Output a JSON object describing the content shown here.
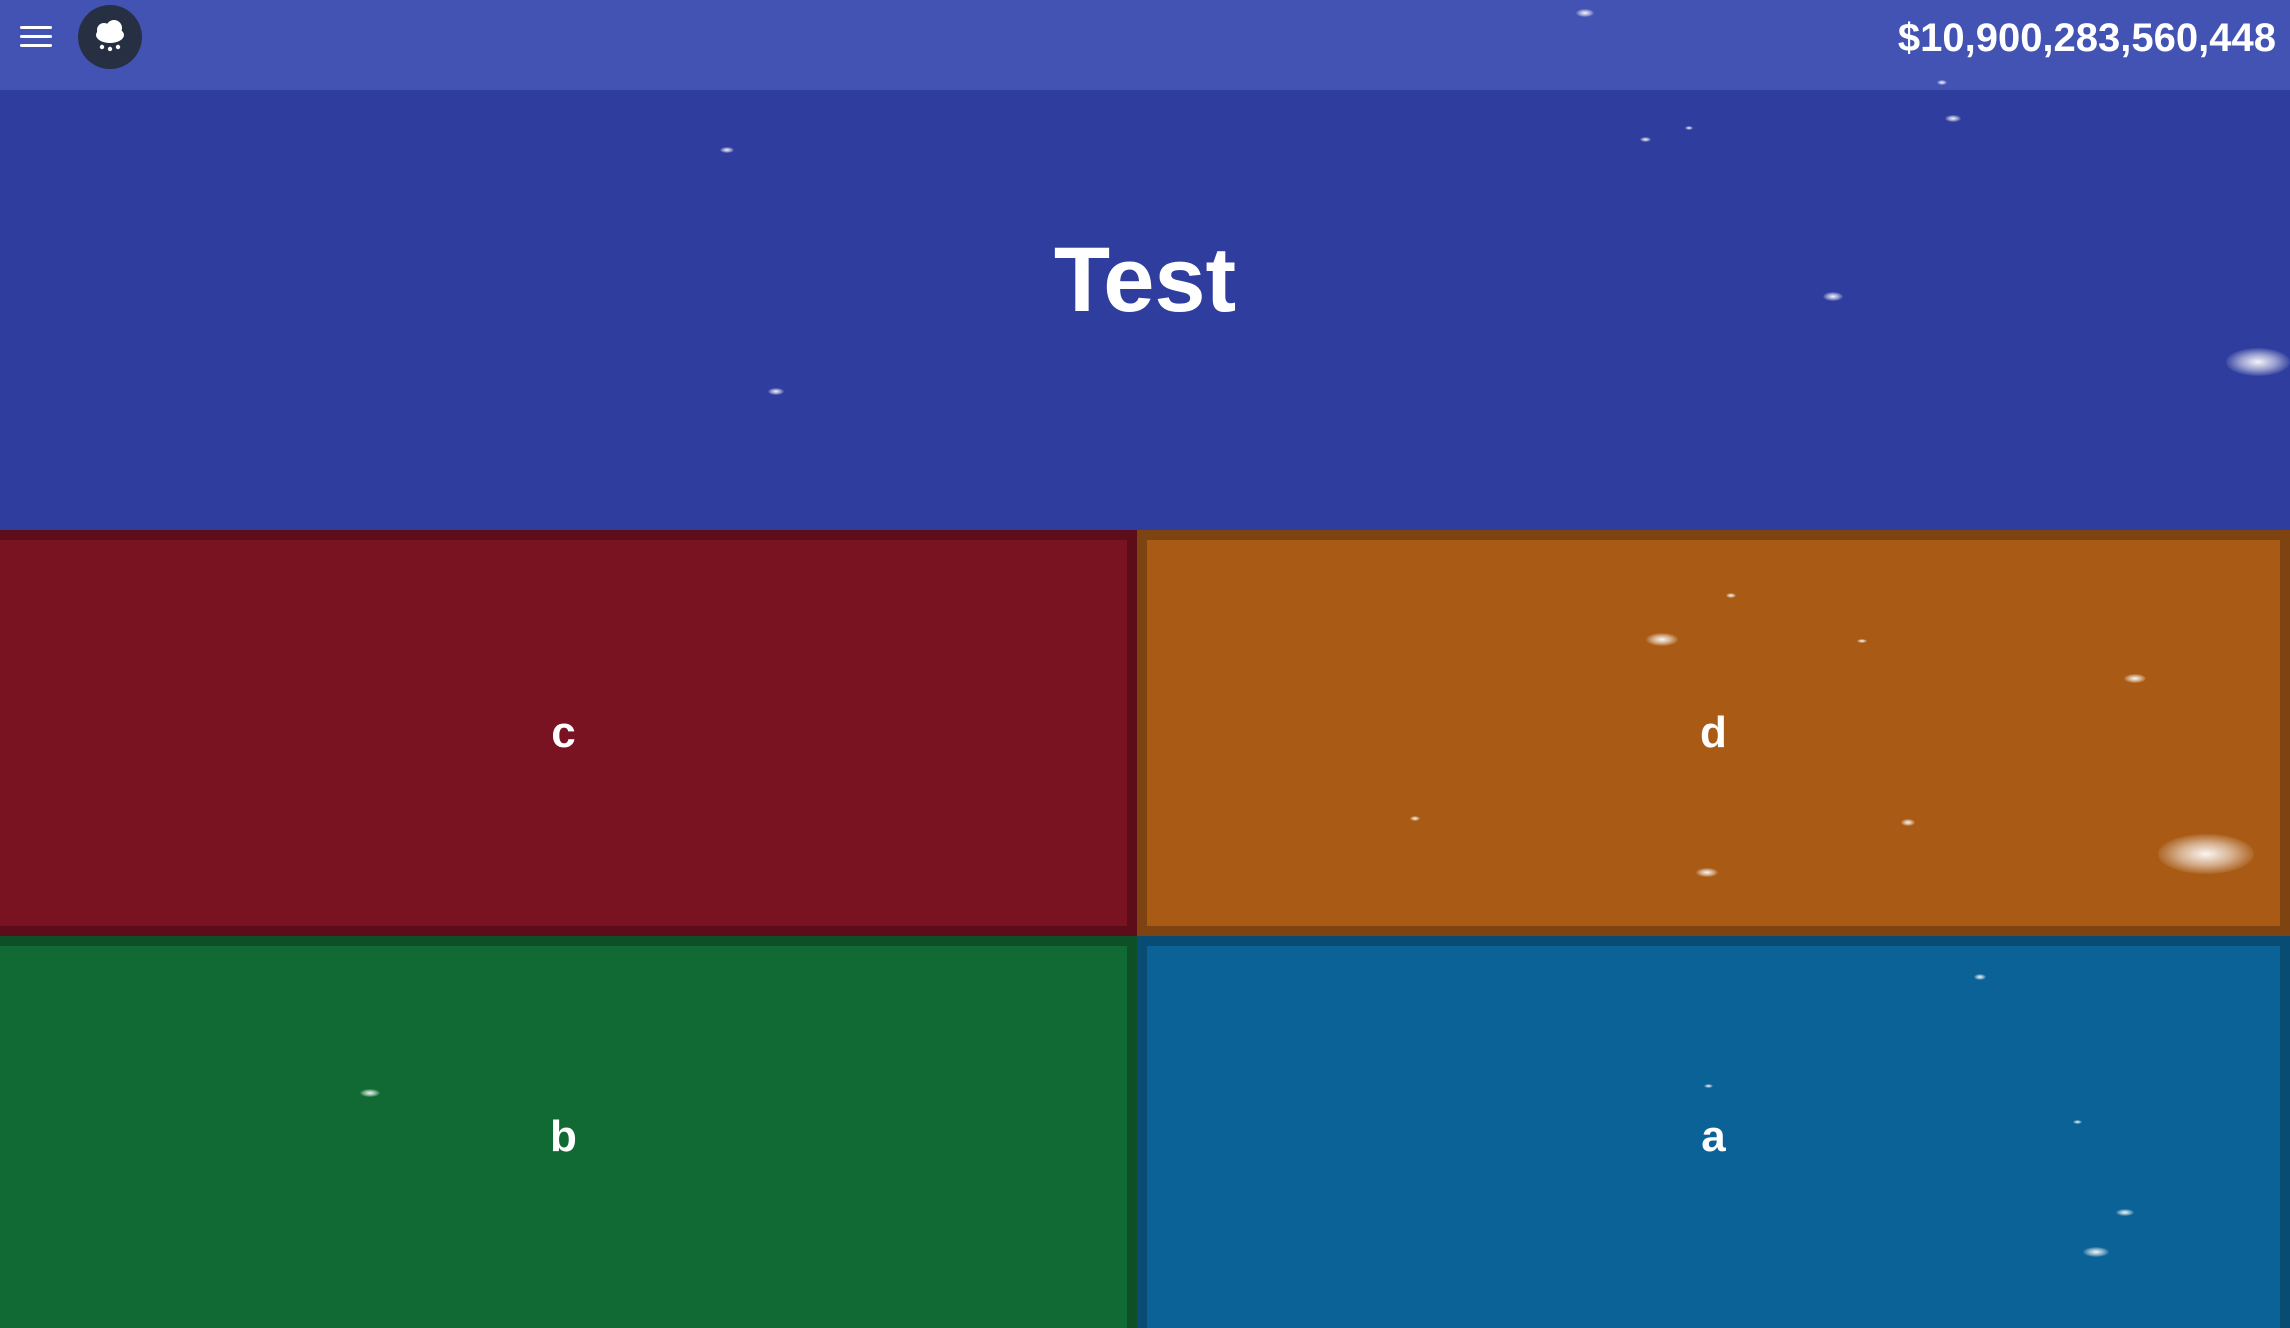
{
  "header": {
    "menu_icon": "hamburger-menu-icon",
    "avatar_icon": "snow-cloud-icon",
    "balance": "$10,900,283,560,448"
  },
  "question": {
    "text": "Test"
  },
  "answers": [
    {
      "label": "c",
      "color": "#791322"
    },
    {
      "label": "d",
      "color": "#a95b16"
    },
    {
      "label": "b",
      "color": "#116934"
    },
    {
      "label": "a",
      "color": "#0b6296"
    }
  ],
  "colors": {
    "header_bg": "#4353b3",
    "question_bg": "#2f3d9e"
  }
}
